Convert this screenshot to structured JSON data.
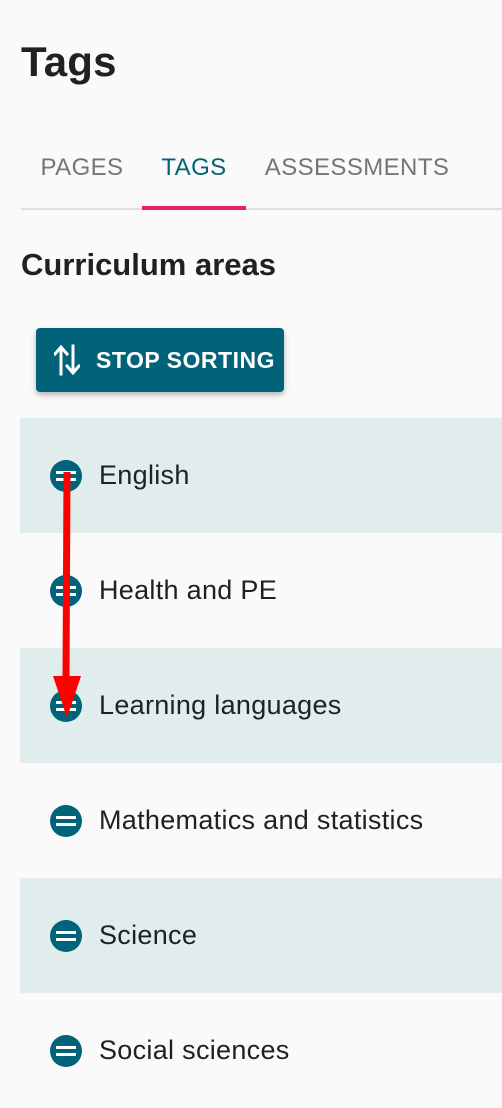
{
  "page": {
    "title": "Tags"
  },
  "tabs": [
    {
      "label": "PAGES",
      "active": false
    },
    {
      "label": "TAGS",
      "active": true
    },
    {
      "label": "ASSESSMENTS",
      "active": false
    }
  ],
  "section": {
    "title": "Curriculum areas"
  },
  "sort_button": {
    "label": "STOP SORTING",
    "icon": "sort-arrows-icon"
  },
  "tags": [
    {
      "label": "English",
      "handle_icon": "drag-handle-icon"
    },
    {
      "label": "Health and PE",
      "handle_icon": "drag-handle-icon"
    },
    {
      "label": "Learning languages",
      "handle_icon": "drag-handle-icon"
    },
    {
      "label": "Mathematics and statistics",
      "handle_icon": "drag-handle-icon"
    },
    {
      "label": "Science",
      "handle_icon": "drag-handle-icon"
    },
    {
      "label": "Social sciences",
      "handle_icon": "drag-handle-icon"
    }
  ],
  "annotation": {
    "type": "drag-arrow",
    "from_item": "English",
    "to_item": "Learning languages",
    "color": "#ff0000"
  },
  "colors": {
    "primary": "#006379",
    "tab_indicator": "#e91e63",
    "row_highlight": "#e1eced",
    "background": "#fafafa"
  }
}
